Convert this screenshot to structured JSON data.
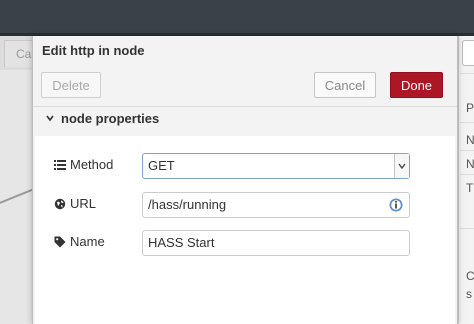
{
  "background": {
    "left_tab_label": "Ca"
  },
  "dialog": {
    "title": "Edit http in node",
    "buttons": {
      "delete_label": "Delete",
      "cancel_label": "Cancel",
      "done_label": "Done"
    },
    "section": {
      "label": "node properties"
    },
    "fields": {
      "method": {
        "label": "Method",
        "value": "GET",
        "icon": "list-icon"
      },
      "url": {
        "label": "URL",
        "value": "/hass/running",
        "icon": "globe-icon"
      },
      "name": {
        "label": "Name",
        "value": "HASS Start",
        "icon": "tag-icon"
      }
    }
  },
  "right_panel": {
    "rows": [
      "P",
      "N",
      "N",
      "T",
      "C",
      "s"
    ]
  },
  "colors": {
    "header": "#3b4148",
    "done_button": "#ad1625"
  }
}
